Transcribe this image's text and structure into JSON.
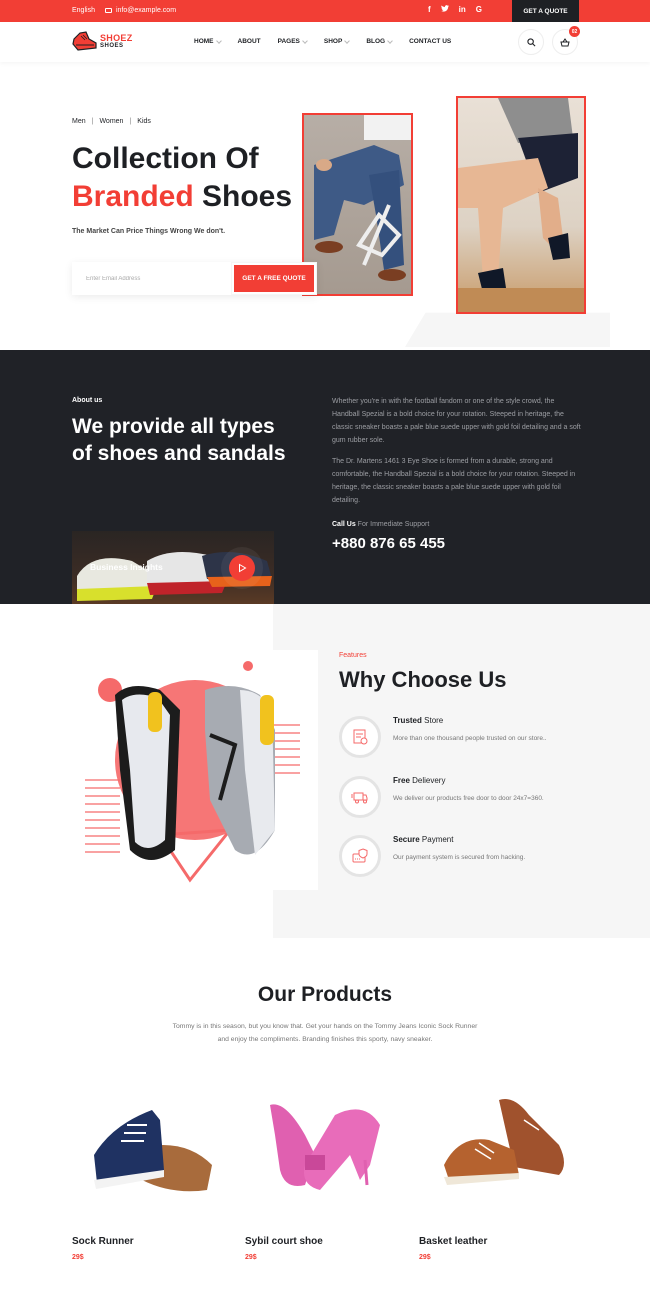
{
  "topbar": {
    "language": "English",
    "email": "info@example.com",
    "social": [
      {
        "name": "facebook-icon",
        "glyph": "f"
      },
      {
        "name": "twitter-icon",
        "glyph": "t"
      },
      {
        "name": "linkedin-icon",
        "glyph": "in"
      },
      {
        "name": "google-icon",
        "glyph": "G"
      }
    ],
    "quote_button": "GET A QUOTE"
  },
  "nav": {
    "logo_top": "SHOEZ",
    "logo_bottom": "SHOES",
    "menu": [
      {
        "label": "HOME",
        "dropdown": true
      },
      {
        "label": "ABOUT",
        "dropdown": false
      },
      {
        "label": "PAGES",
        "dropdown": true
      },
      {
        "label": "SHOP",
        "dropdown": true
      },
      {
        "label": "BLOG",
        "dropdown": true
      },
      {
        "label": "CONTACT US",
        "dropdown": false
      }
    ],
    "cart_count": "02"
  },
  "hero": {
    "categories": [
      "Men",
      "Women",
      "Kids"
    ],
    "separator": "|",
    "title_line1": "Collection Of",
    "title_highlight": "Branded",
    "title_rest": " Shoes",
    "subtitle": "The Market Can Price Things Wrong We don't.",
    "email_placeholder": "Enter Email Address",
    "cta": "GET A FREE QUOTE"
  },
  "about": {
    "label": "About us",
    "title": "We provide all types of shoes and sandals",
    "video_label": "Business Insights",
    "paragraph1": "Whether you're in with the football fandom or one of the style crowd, the Handball Spezial is a bold choice for your rotation. Steeped in heritage, the classic sneaker boasts a pale blue suede upper with gold foil detailing and a soft gum rubber sole.",
    "paragraph2": "The Dr. Martens 1461 3 Eye Shoe is formed from a durable, strong and comfortable, the Handball Spezial is a bold choice for your rotation. Steeped in heritage, the classic sneaker boasts a pale blue suede upper with gold foil detailing.",
    "call_bold": "Call Us",
    "call_rest": " For Immediate Support",
    "phone": "+880 876 65 455"
  },
  "why": {
    "label": "Features",
    "title": "Why Choose Us",
    "features": [
      {
        "bold": "Trusted",
        "rest": " Store",
        "desc": "More than one thousand people trusted on our store..",
        "icon": "certificate-icon"
      },
      {
        "bold": "Free",
        "rest": " Delievery",
        "desc": "We deliver our products free door to door 24x7=360.",
        "icon": "delivery-truck-icon"
      },
      {
        "bold": "Secure",
        "rest": " Payment",
        "desc": "Our payment system is secured from hacking.",
        "icon": "secure-card-icon"
      }
    ]
  },
  "products": {
    "title": "Our Products",
    "subtitle": "Tommy is in this season, but you know that. Get your hands on the Tommy Jeans Iconic Sock Runner and enjoy the compliments. Branding finishes this sporty, navy sneaker.",
    "items": [
      {
        "name": "Sock Runner",
        "price": "29$"
      },
      {
        "name": "Sybil court shoe",
        "price": "29$"
      },
      {
        "name": "Basket leather",
        "price": "29$"
      }
    ]
  },
  "colors": {
    "accent": "#f23e35",
    "dark": "#1e2024",
    "dark_section": "#202227",
    "light_bg": "#f6f6f6"
  }
}
